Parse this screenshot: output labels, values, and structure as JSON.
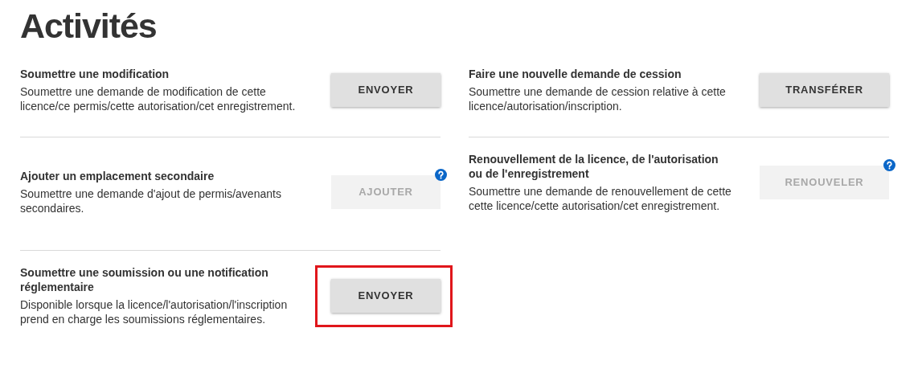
{
  "title": "Activités",
  "columns": [
    {
      "activities": [
        {
          "title": "Soumettre une modification",
          "description": "Soumettre une demande de modification de cette licence/ce permis/cette autorisation/cet enregistrement.",
          "button": {
            "label": "ENVOYER",
            "disabled": false,
            "help": false
          },
          "highlighted": false
        },
        {
          "title": "Ajouter un emplacement secondaire",
          "description": "Soumettre une demande d'ajout de permis/avenants secondaires.",
          "button": {
            "label": "AJOUTER",
            "disabled": true,
            "help": true
          },
          "highlighted": false
        },
        {
          "title": "Soumettre une soumission ou une notification réglementaire",
          "description": "Disponible lorsque la licence/l'autorisation/l'inscription prend en charge les soumissions réglementaires.",
          "button": {
            "label": "ENVOYER",
            "disabled": false,
            "help": false
          },
          "highlighted": true
        }
      ]
    },
    {
      "activities": [
        {
          "title": "Faire une nouvelle demande de cession",
          "description": "Soumettre une demande de cession relative à cette licence/autorisation/inscription.",
          "button": {
            "label": "TRANSFÉRER",
            "disabled": false,
            "help": false
          },
          "highlighted": false
        },
        {
          "title": "Renouvellement de la licence, de l'autorisation ou de l'enregistrement",
          "description": "Soumettre une demande de renouvellement de cette cette licence/cette autorisation/cet enregistrement.",
          "button": {
            "label": "RENOUVELER",
            "disabled": true,
            "help": true
          },
          "highlighted": false
        }
      ]
    }
  ]
}
